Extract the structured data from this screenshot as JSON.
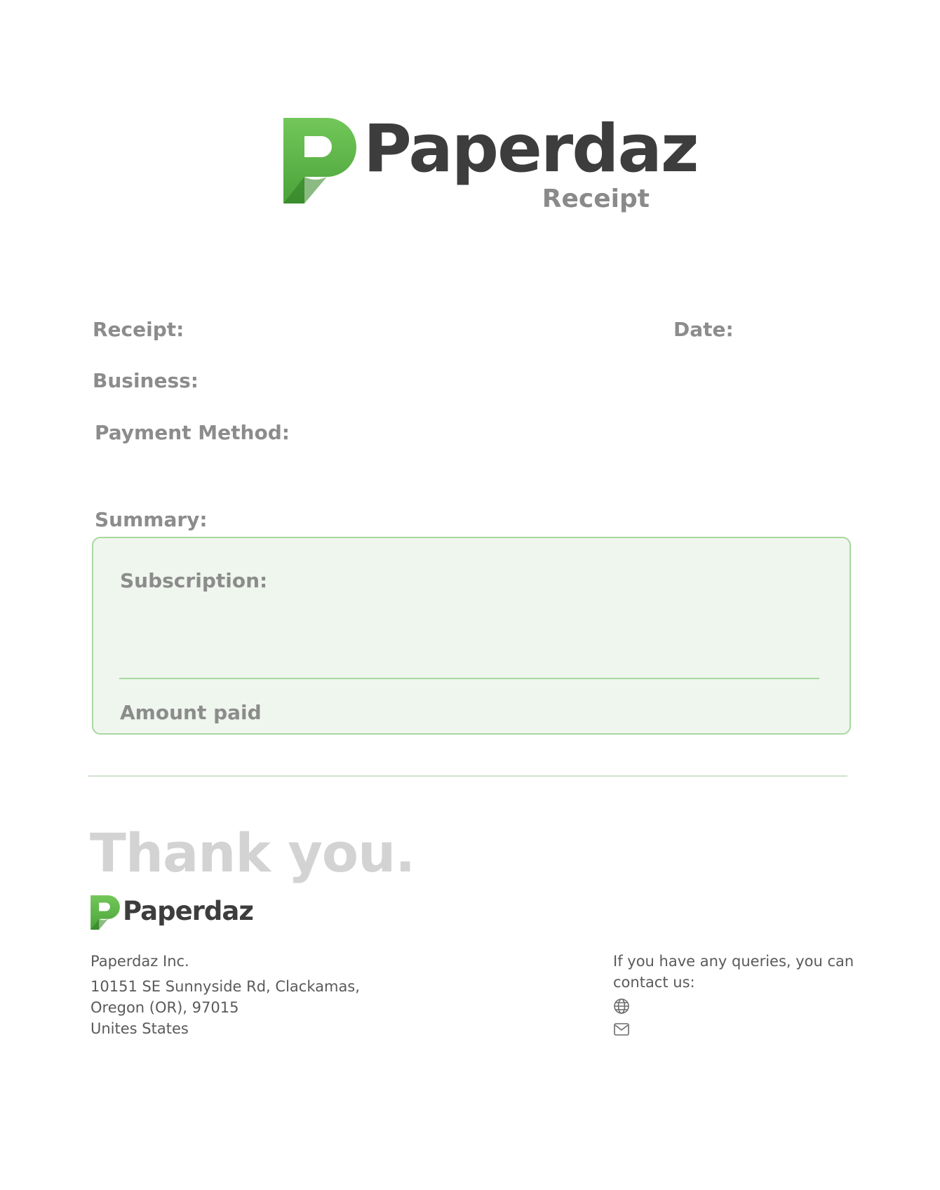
{
  "brand": {
    "name": "Paperdaz",
    "subtitle": "Receipt",
    "colors": {
      "green": "#6cc24a",
      "green_dark": "#3e8e2f",
      "text": "#3d3d3d"
    }
  },
  "fields": {
    "receipt_label": "Receipt:",
    "date_label": "Date:",
    "business_label": "Business:",
    "payment_method_label": "Payment Method:",
    "summary_label": "Summary:"
  },
  "summary": {
    "subscription_label": "Subscription:",
    "amount_paid_label": "Amount paid"
  },
  "footer": {
    "thank_you": "Thank you.",
    "brand_name": "Paperdaz",
    "company": "Paperdaz Inc.",
    "address_line1": "10151 SE Sunnyside Rd, Clackamas,",
    "address_line2": "Oregon (OR), 97015",
    "address_line3": "Unites States",
    "contact_line1": "If you have any queries, you can",
    "contact_line2": "contact us:",
    "icons": [
      "globe-icon",
      "mail-icon"
    ]
  }
}
